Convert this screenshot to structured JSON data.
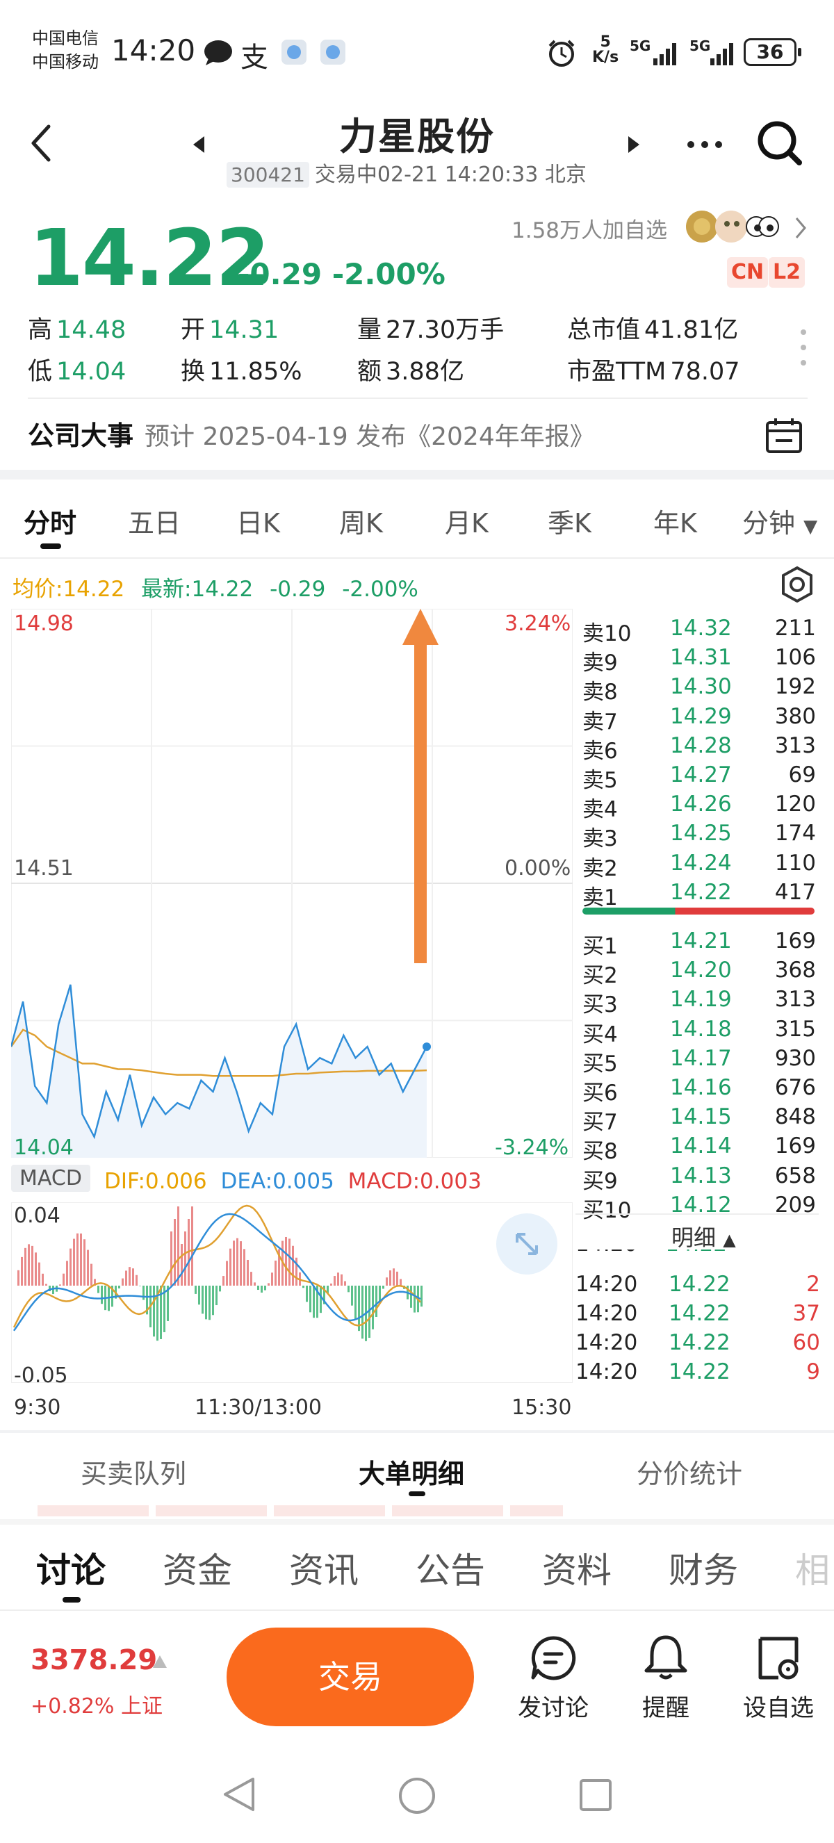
{
  "status_bar": {
    "carrier_1": "中国电信",
    "carrier_2": "中国移动",
    "time": "14:20",
    "net_speed": "5",
    "net_speed_unit": "K/s",
    "sig1": "5G",
    "sig2": "5G",
    "battery": "36"
  },
  "header": {
    "title": "力星股份",
    "code": "300421",
    "status": "交易中02-21 14:20:33 北京"
  },
  "quote": {
    "price": "14.22",
    "change": "-0.29",
    "change_pct": "-2.00%",
    "watchers": "1.58万人加自选",
    "tag_cn": "CN",
    "tag_l2": "L2",
    "high_label": "高",
    "high": "14.48",
    "low_label": "低",
    "low": "14.04",
    "open_label": "开",
    "open": "14.31",
    "turnover_label": "换",
    "turnover": "11.85%",
    "volume_label": "量",
    "volume": "27.30万手",
    "amount_label": "额",
    "amount": "3.88亿",
    "mcap_label": "总市值",
    "mcap": "41.81亿",
    "pe_label": "市盈TTM",
    "pe": "78.07"
  },
  "event": {
    "label": "公司大事",
    "text": "预计 2025-04-19 发布《2024年年报》"
  },
  "chart_tabs": [
    "分时",
    "五日",
    "日K",
    "周K",
    "月K",
    "季K",
    "年K",
    "分钟"
  ],
  "legend": {
    "avg": "均价:14.22",
    "latest": "最新:14.22",
    "chg": "-0.29",
    "pct": "-2.00%"
  },
  "macd": {
    "label": "MACD",
    "dif": "DIF:0.006",
    "dea": "DEA:0.005",
    "macd": "MACD:0.003",
    "y_top": "0.04",
    "y_bottom": "-0.05"
  },
  "chart_data": {
    "type": "line",
    "y_left_labels": [
      "14.98",
      "14.51",
      "14.04"
    ],
    "y_right_labels": [
      "3.24%",
      "0.00%",
      "-3.24%"
    ],
    "x_labels": [
      "9:30",
      "11:30/13:00",
      "15:30"
    ],
    "ylim": [
      14.04,
      14.98
    ],
    "series": [
      {
        "name": "price",
        "values": [
          14.22,
          14.3,
          14.15,
          14.12,
          14.26,
          14.33,
          14.1,
          14.06,
          14.14,
          14.09,
          14.17,
          14.08,
          14.13,
          14.1,
          14.12,
          14.11,
          14.16,
          14.14,
          14.2,
          14.14,
          14.07,
          14.12,
          14.1,
          14.22,
          14.26,
          14.18,
          14.2,
          14.19,
          14.24,
          14.2,
          14.22,
          14.17,
          14.19,
          14.14,
          14.18,
          14.22
        ]
      },
      {
        "name": "avg",
        "values": [
          14.22,
          14.25,
          14.24,
          14.22,
          14.21,
          14.2,
          14.19,
          14.19,
          14.185,
          14.18,
          14.18,
          14.178,
          14.175,
          14.172,
          14.17,
          14.17,
          14.17,
          14.168,
          14.168,
          14.168,
          14.168,
          14.168,
          14.168,
          14.17,
          14.172,
          14.172,
          14.174,
          14.175,
          14.176,
          14.176,
          14.177,
          14.177,
          14.177,
          14.177,
          14.177,
          14.178
        ]
      }
    ]
  },
  "order_book": {
    "asks": [
      {
        "label": "卖10",
        "price": "14.32",
        "vol": "211"
      },
      {
        "label": "卖9",
        "price": "14.31",
        "vol": "106"
      },
      {
        "label": "卖8",
        "price": "14.30",
        "vol": "192"
      },
      {
        "label": "卖7",
        "price": "14.29",
        "vol": "380"
      },
      {
        "label": "卖6",
        "price": "14.28",
        "vol": "313"
      },
      {
        "label": "卖5",
        "price": "14.27",
        "vol": "69"
      },
      {
        "label": "卖4",
        "price": "14.26",
        "vol": "120"
      },
      {
        "label": "卖3",
        "price": "14.25",
        "vol": "174"
      },
      {
        "label": "卖2",
        "price": "14.24",
        "vol": "110"
      },
      {
        "label": "卖1",
        "price": "14.22",
        "vol": "417"
      }
    ],
    "bids": [
      {
        "label": "买1",
        "price": "14.21",
        "vol": "169"
      },
      {
        "label": "买2",
        "price": "14.20",
        "vol": "368"
      },
      {
        "label": "买3",
        "price": "14.19",
        "vol": "313"
      },
      {
        "label": "买4",
        "price": "14.18",
        "vol": "315"
      },
      {
        "label": "买5",
        "price": "14.17",
        "vol": "930"
      },
      {
        "label": "买6",
        "price": "14.16",
        "vol": "676"
      },
      {
        "label": "买7",
        "price": "14.15",
        "vol": "848"
      },
      {
        "label": "买8",
        "price": "14.14",
        "vol": "169"
      },
      {
        "label": "买9",
        "price": "14.13",
        "vol": "658"
      },
      {
        "label": "买10",
        "price": "14.12",
        "vol": "209"
      }
    ]
  },
  "ticks": {
    "header": "明细",
    "rows": [
      {
        "time": "14:20",
        "price": "14.22",
        "vol": "2"
      },
      {
        "time": "14:20",
        "price": "14.22",
        "vol": "37"
      },
      {
        "time": "14:20",
        "price": "14.22",
        "vol": "60"
      },
      {
        "time": "14:20",
        "price": "14.22",
        "vol": "9"
      }
    ]
  },
  "sub_tabs": [
    "买卖队列",
    "大单明细",
    "分价统计"
  ],
  "news_tabs": [
    "讨论",
    "资金",
    "资讯",
    "公告",
    "资料",
    "财务",
    "相"
  ],
  "bottom_bar": {
    "index_value": "3378.29",
    "index_change": "+0.82% 上证",
    "trade_button": "交易",
    "discuss": "发讨论",
    "remind": "提醒",
    "add_watch": "设自选"
  }
}
